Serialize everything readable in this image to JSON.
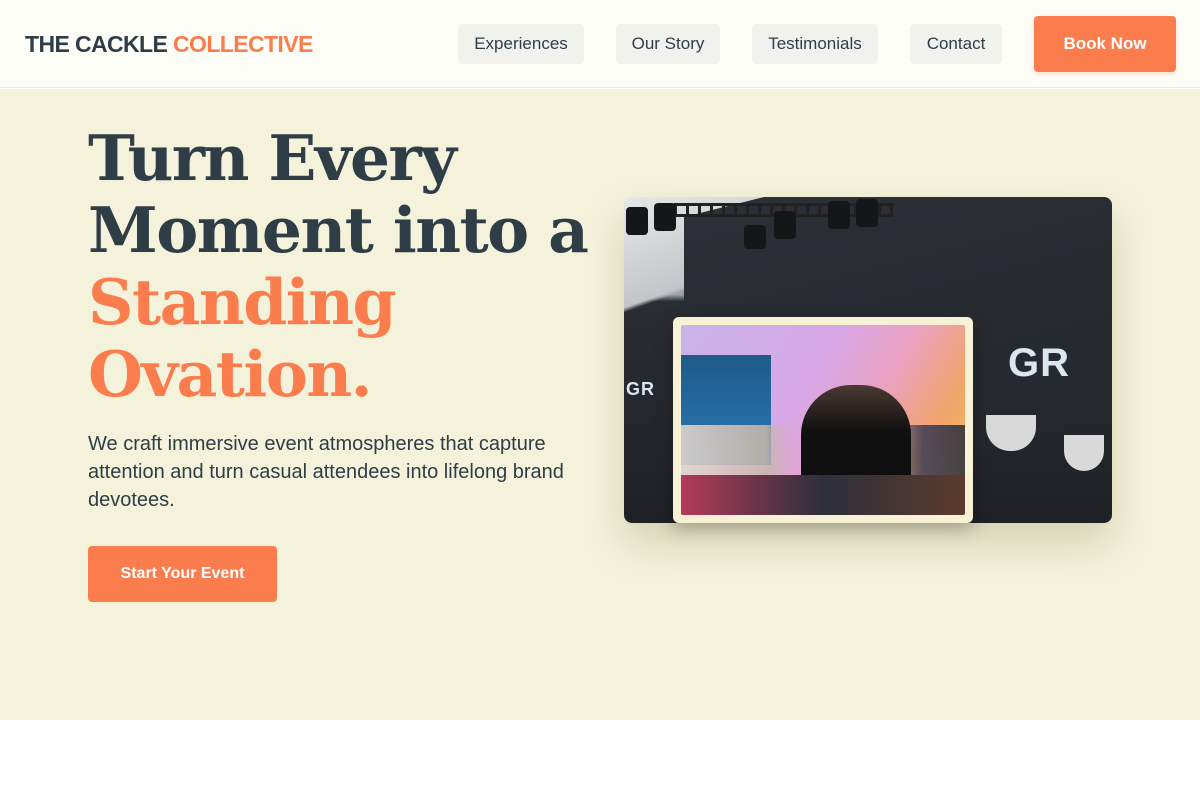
{
  "header": {
    "logo_main": "THE CACKLE",
    "logo_accent": "COLLECTIVE",
    "nav": [
      {
        "label": "Experiences"
      },
      {
        "label": "Our Story"
      },
      {
        "label": "Testimonials"
      },
      {
        "label": "Contact"
      }
    ],
    "book_label": "Book Now"
  },
  "hero": {
    "headline_line1": "Turn Every",
    "headline_line2": "Moment into a",
    "headline_accent1": "Standing",
    "headline_accent2": "Ovation.",
    "subtitle": "We craft immersive event atmospheres that capture attention and turn casual attendees into lifelong brand devotees.",
    "cta_label": "Start Your Event"
  },
  "colors": {
    "accent": "#fb7d4d",
    "hero_bg": "#f4f2db",
    "text": "#2f3d47"
  }
}
